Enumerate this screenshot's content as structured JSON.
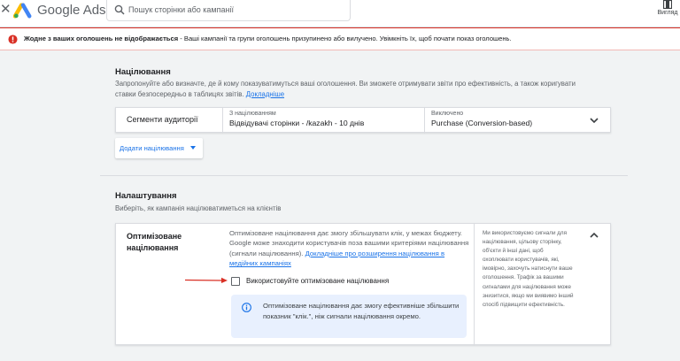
{
  "header": {
    "brand": "Google Ads",
    "search_placeholder": "Пошук сторінки або кампанії",
    "view_label": "Вигляд",
    "icons": {
      "close": "close-icon",
      "logo": "google-ads-logo",
      "search": "search-icon",
      "view": "view-icon"
    }
  },
  "alert": {
    "bold": "Жодне з ваших оголошень не відображається",
    "text": " - Ваші кампанії та групи оголошень призупинено або вилучено. Увімкніть їх, щоб почати показ оголошень.",
    "icon": "error-icon",
    "color": "#d93025"
  },
  "targeting": {
    "title": "Націлювання",
    "desc": "Запропонуйте або визначте, де й кому показуватимуться ваші оголошення. Ви зможете отримувати звіти про ефективність, а також коригувати ставки безпосередньо в таблицях звітів.",
    "more_link": "Докладніше",
    "row": {
      "name": "Сегменти аудиторії",
      "col1_caption": "З націлюванням",
      "col1_value": "Відвідувачі сторінки - /kazakh - 10 днів",
      "col2_caption": "Виключено",
      "col2_value": "Purchase (Conversion-based)"
    },
    "add_button": "Додати націлювання"
  },
  "settings": {
    "title": "Налаштування",
    "desc": "Виберіть, як кампанія націлюватиметься на клієнтів",
    "card": {
      "name": "Оптимізоване націлювання",
      "desc": "Оптимізоване націлювання дає змогу збільшувати клік, у межах бюджету. Google може знаходити користувачів поза вашими критеріями націлювання (сигнали націлювання).",
      "link": "Докладніше про розширення націлювання в медійних кампаніях",
      "checkbox_label": "Використовуйте оптимізоване націлювання",
      "checkbox_checked": false,
      "info": "Оптимізоване націлювання дає змогу ефективніше збільшити показник \"клік.\", ніж сигнали націлювання окремо.",
      "side": "Ми використовуємо сигнали для націлювання, цільову сторінку, об'єкти й інші дані, щоб охоплювати користувачів, які, імовірно, захочуть натиснути ваше оголошення. Трафік за вашими сигналами для націлювання може знизитися, якщо ми виявимо інший спосіб підвищити ефективність."
    }
  },
  "colors": {
    "accent": "#1a73e8",
    "error": "#d93025",
    "info_bg": "#e8f0fe",
    "annotation_arrow": "#d93025"
  }
}
